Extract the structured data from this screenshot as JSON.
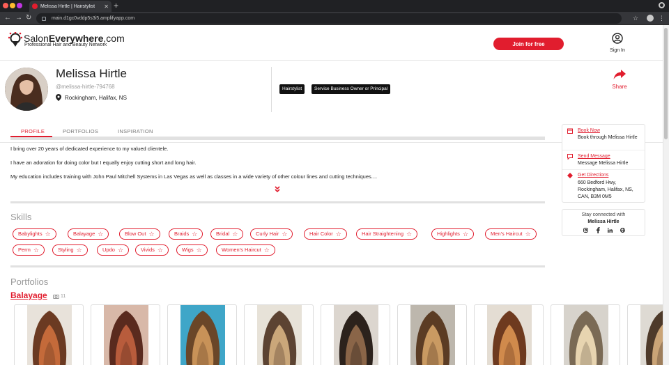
{
  "browser": {
    "tab_title": "Melissa Hirtle | Hairstylist",
    "url": "main.d1gc0vddp5s3i5.amplifyapp.com"
  },
  "header": {
    "logo_name_plain": "Salon",
    "logo_name_bold": "Everywhere",
    "logo_name_suffix": ".com",
    "logo_tagline": "Professional Hair and Beauty Network",
    "join_label": "Join for free",
    "signin_label": "Sign In"
  },
  "profile": {
    "name": "Melissa Hirtle",
    "handle": "@melissa-hirtle-794768",
    "location": "Rockingham, Halifax, NS",
    "badges": [
      "Hairstylist",
      "Service Business Owner or Principal"
    ],
    "share_label": "Share"
  },
  "tabs": [
    "PROFILE",
    "PORTFOLIOS",
    "INSPIRATION"
  ],
  "bio": [
    "I bring over 20 years of dedicated experience to my valued clientele.",
    "I have an adoration for doing color but I equally enjoy cutting short and long hair.",
    "My education includes training with John Paul Mitchell Systems in Las Vegas as well as classes in a wide variety of other colour lines and cutting techniques...."
  ],
  "skills": {
    "title": "Skills",
    "items": [
      "Babylights",
      "Balayage",
      "Blow Out",
      "Braids",
      "Bridal",
      "Curly Hair",
      "Hair Color",
      "Hair Straightening",
      "Highlights",
      "Men's Haircut",
      "Perm",
      "Styling",
      "Updo",
      "Vivids",
      "Wigs",
      "Women's Haircut"
    ]
  },
  "portfolios": {
    "title": "Portfolios",
    "album_name": "Balayage",
    "album_count": "11"
  },
  "contact": {
    "book_label": "Book Now",
    "book_text": "Book through Melissa Hirtle",
    "message_label": "Send Message",
    "message_text": "Message Melissa Hirtle",
    "directions_label": "Get Directions",
    "address": "660 Bedford Hwy, Rockingham, Halifax, NS, CAN, B3M 0M5"
  },
  "stay_connected": {
    "title": "Stay connected with",
    "name": "Melissa Hirtle",
    "icons": [
      "instagram-icon",
      "facebook-icon",
      "linkedin-icon",
      "website-icon"
    ]
  },
  "colors": {
    "accent": "#e11d2e",
    "badge_bg": "#111111"
  }
}
